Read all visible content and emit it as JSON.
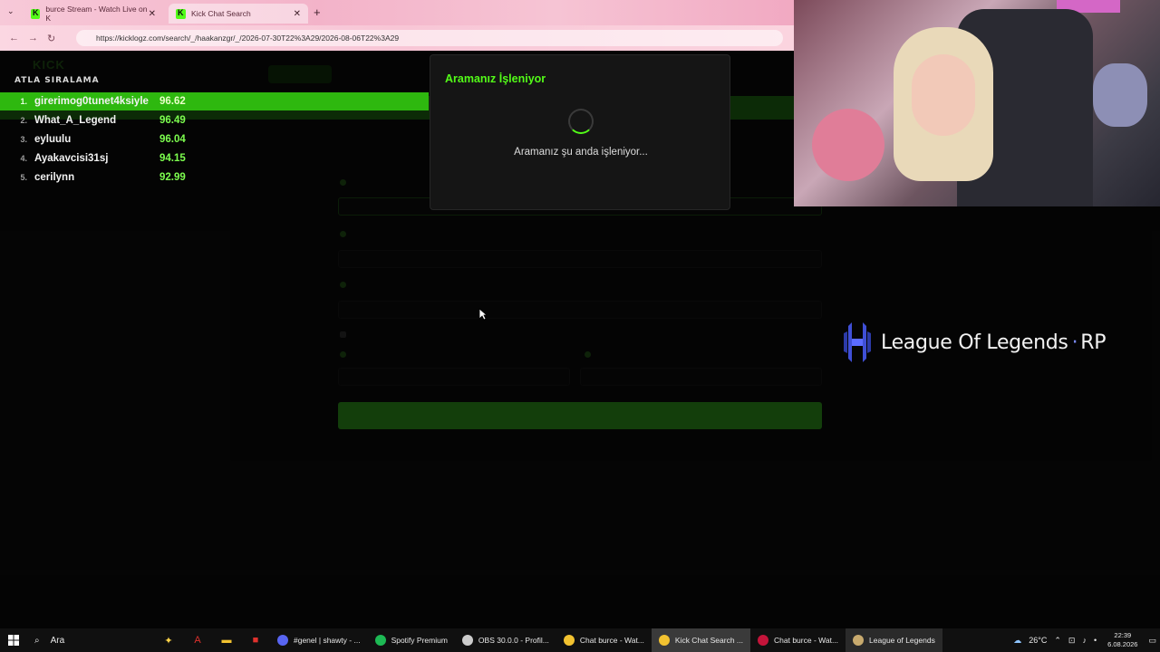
{
  "browser": {
    "tabs": [
      {
        "label": "burce Stream - Watch Live on K"
      },
      {
        "label": "Kick Chat Search"
      }
    ],
    "url": "https://kicklogz.com/search/_/haakanzgr/_/2026-07-30T22%3A29/2026-08-06T22%3A29"
  },
  "leaderboard": {
    "title": "ATLA SIRALAMA",
    "rows": [
      {
        "rank": "1.",
        "name": "girerimog0tunet4ksiyle",
        "score": "96.62"
      },
      {
        "rank": "2.",
        "name": "What_A_Legend",
        "score": "96.49"
      },
      {
        "rank": "3.",
        "name": "eyluulu",
        "score": "96.04"
      },
      {
        "rank": "4.",
        "name": "Ayakavcisi31sj",
        "score": "94.15"
      },
      {
        "rank": "5.",
        "name": "cerilynn",
        "score": "92.99"
      }
    ]
  },
  "modal": {
    "title": "Aramanız İşleniyor",
    "message": "Aramanız şu anda işleniyor..."
  },
  "brand": {
    "name": "League Of Legends",
    "suffix": "RP",
    "colors": {
      "icon": "#3f4fd6",
      "dot": "#7b8cff"
    }
  },
  "taskbar": {
    "search_placeholder": "Ara",
    "apps": [
      {
        "label": "#genel | shawty - ...",
        "icon": "discord-icon",
        "color": "#5865f2"
      },
      {
        "label": "Spotify Premium",
        "icon": "spotify-icon",
        "color": "#1db954"
      },
      {
        "label": "OBS 30.0.0 - Profil...",
        "icon": "obs-icon",
        "color": "#cccccc"
      },
      {
        "label": "Chat burce - Wat...",
        "icon": "chrome-icon",
        "color": "#f2c230"
      },
      {
        "label": "Kick Chat Search ...",
        "icon": "chrome-icon",
        "color": "#f2c230",
        "active": true
      },
      {
        "label": "Chat burce - Wat...",
        "icon": "opera-icon",
        "color": "#c4143a"
      },
      {
        "label": "League of Legends",
        "icon": "lol-icon",
        "color": "#c8aa6e"
      }
    ],
    "weather": "26°C",
    "time": "22:39",
    "date": "6.08.2026"
  },
  "colors": {
    "kick_green": "#53fc18",
    "leaderboard_highlight": "#2eb80f"
  }
}
